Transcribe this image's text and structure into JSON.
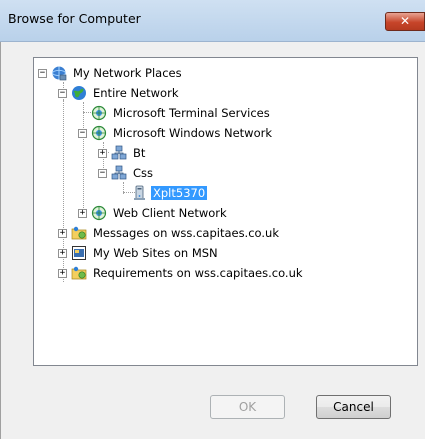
{
  "window": {
    "title": "Browse for Computer",
    "close_glyph": "✕"
  },
  "tree": {
    "items": [
      {
        "label": "My Network Places",
        "expander": "−",
        "icon": "network-places-icon"
      },
      {
        "label": "Entire Network",
        "expander": "−",
        "icon": "globe-icon"
      },
      {
        "label": "Microsoft Terminal Services",
        "expander": "",
        "icon": "network-icon"
      },
      {
        "label": "Microsoft Windows Network",
        "expander": "−",
        "icon": "network-icon"
      },
      {
        "label": "Bt",
        "expander": "+",
        "icon": "workgroup-icon"
      },
      {
        "label": "Css",
        "expander": "−",
        "icon": "workgroup-icon"
      },
      {
        "label": "Xplt5370",
        "expander": "",
        "icon": "computer-icon",
        "selected": true
      },
      {
        "label": "Web Client Network",
        "expander": "+",
        "icon": "network-icon"
      },
      {
        "label": "Messages on wss.capitaes.co.uk",
        "expander": "+",
        "icon": "web-folder-icon"
      },
      {
        "label": "My Web Sites on MSN",
        "expander": "+",
        "icon": "web-sites-icon"
      },
      {
        "label": "Requirements on wss.capitaes.co.uk",
        "expander": "+",
        "icon": "web-folder-icon"
      }
    ]
  },
  "buttons": {
    "ok": "OK",
    "cancel": "Cancel"
  },
  "colors": {
    "selection": "#3399ff",
    "close": "#c7452a"
  }
}
